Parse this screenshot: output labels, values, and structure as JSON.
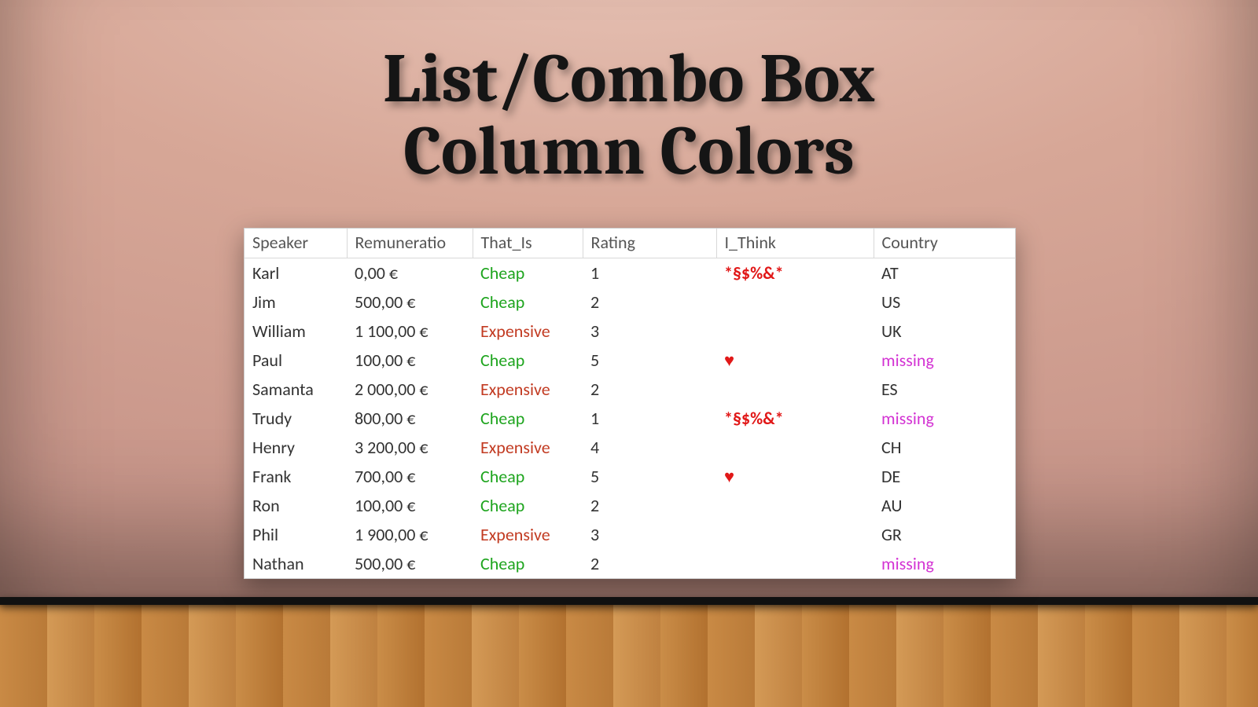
{
  "title": "List/Combo Box\nColumn Colors",
  "headers": {
    "speaker": "Speaker",
    "remuneration": "Remuneratio",
    "that_is": "That_Is",
    "rating": "Rating",
    "i_think": "I_Think",
    "country": "Country"
  },
  "that_is_values": {
    "cheap": "Cheap",
    "expensive": "Expensive"
  },
  "i_think_values": {
    "symbols": "*§$%&*",
    "heart": "♥"
  },
  "country_missing": "missing",
  "rows": [
    {
      "speaker": "Karl",
      "remun": "0,00 €",
      "that_is": "cheap",
      "rating": "1",
      "i_think": "symbols",
      "country": "AT"
    },
    {
      "speaker": "Jim",
      "remun": "500,00 €",
      "that_is": "cheap",
      "rating": "2",
      "i_think": "",
      "country": "US"
    },
    {
      "speaker": "William",
      "remun": "1 100,00 €",
      "that_is": "expensive",
      "rating": "3",
      "i_think": "",
      "country": "UK"
    },
    {
      "speaker": "Paul",
      "remun": "100,00 €",
      "that_is": "cheap",
      "rating": "5",
      "i_think": "heart",
      "country": "missing"
    },
    {
      "speaker": "Samanta",
      "remun": "2 000,00 €",
      "that_is": "expensive",
      "rating": "2",
      "i_think": "",
      "country": "ES"
    },
    {
      "speaker": "Trudy",
      "remun": "800,00 €",
      "that_is": "cheap",
      "rating": "1",
      "i_think": "symbols",
      "country": "missing"
    },
    {
      "speaker": "Henry",
      "remun": "3 200,00 €",
      "that_is": "expensive",
      "rating": "4",
      "i_think": "",
      "country": "CH"
    },
    {
      "speaker": "Frank",
      "remun": "700,00 €",
      "that_is": "cheap",
      "rating": "5",
      "i_think": "heart",
      "country": "DE"
    },
    {
      "speaker": "Ron",
      "remun": "100,00 €",
      "that_is": "cheap",
      "rating": "2",
      "i_think": "",
      "country": "AU"
    },
    {
      "speaker": "Phil",
      "remun": "1 900,00 €",
      "that_is": "expensive",
      "rating": "3",
      "i_think": "",
      "country": "GR"
    },
    {
      "speaker": "Nathan",
      "remun": "500,00 €",
      "that_is": "cheap",
      "rating": "2",
      "i_think": "",
      "country": "missing"
    }
  ]
}
